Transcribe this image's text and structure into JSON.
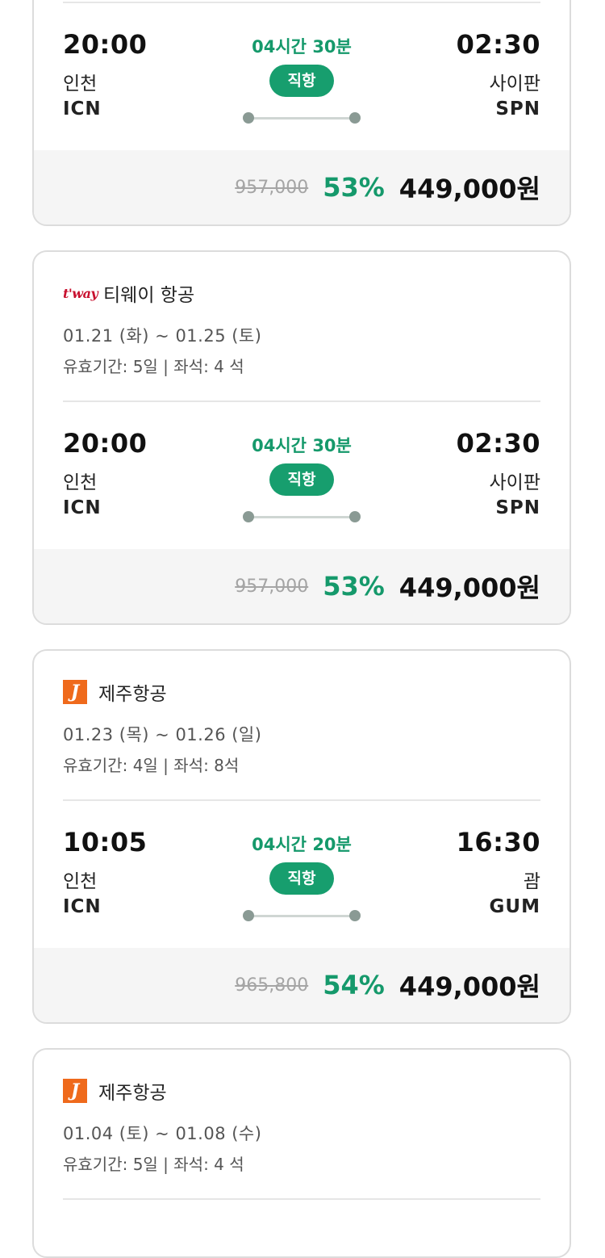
{
  "cards": [
    {
      "flight": {
        "dep_time": "20:00",
        "dep_city": "인천",
        "dep_code": "ICN",
        "duration": "04시간 30분",
        "type": "직항",
        "arr_time": "02:30",
        "arr_city": "사이판",
        "arr_code": "SPN"
      },
      "price": {
        "original": "957,000",
        "discount": "53%",
        "final": "449,000원"
      }
    },
    {
      "airline": {
        "logo": "t'way",
        "name": "티웨이 항공"
      },
      "dates": "01.21 (화) ~ 01.25 (토)",
      "validity": "유효기간: 5일 | 좌석: 4 석",
      "flight": {
        "dep_time": "20:00",
        "dep_city": "인천",
        "dep_code": "ICN",
        "duration": "04시간 30분",
        "type": "직항",
        "arr_time": "02:30",
        "arr_city": "사이판",
        "arr_code": "SPN"
      },
      "price": {
        "original": "957,000",
        "discount": "53%",
        "final": "449,000원"
      }
    },
    {
      "airline": {
        "logo": "J",
        "name": "제주항공"
      },
      "dates": "01.23 (목) ~ 01.26 (일)",
      "validity": "유효기간: 4일 | 좌석: 8석",
      "flight": {
        "dep_time": "10:05",
        "dep_city": "인천",
        "dep_code": "ICN",
        "duration": "04시간 20분",
        "type": "직항",
        "arr_time": "16:30",
        "arr_city": "괌",
        "arr_code": "GUM"
      },
      "price": {
        "original": "965,800",
        "discount": "54%",
        "final": "449,000원"
      }
    },
    {
      "airline": {
        "logo": "J",
        "name": "제주항공"
      },
      "dates": "01.04 (토) ~ 01.08 (수)",
      "validity": "유효기간: 5일 | 좌석: 4 석"
    }
  ]
}
